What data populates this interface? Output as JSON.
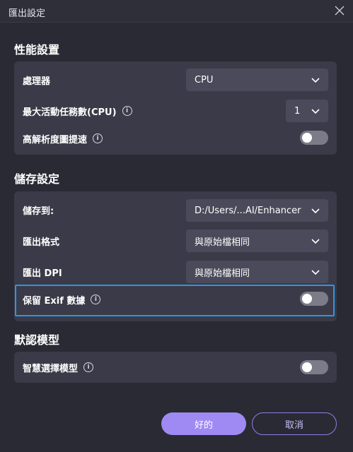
{
  "dialog": {
    "title": "匯出設定"
  },
  "performance": {
    "title": "性能設置",
    "processor_label": "處理器",
    "processor_value": "CPU",
    "max_tasks_label": "最大活動任務數(CPU)",
    "max_tasks_value": "1",
    "hires_accel_label": "高解析度圖提速",
    "hires_accel_enabled": false
  },
  "storage": {
    "title": "儲存設定",
    "save_to_label": "儲存到:",
    "save_to_value": "D:/Users/...AI/Enhancer",
    "export_format_label": "匯出格式",
    "export_format_value": "與原始檔相同",
    "export_dpi_label": "匯出 DPI",
    "export_dpi_value": "與原始檔相同",
    "keep_exif_label": "保留 Exif 數據",
    "keep_exif_enabled": false
  },
  "default_model": {
    "title": "默認模型",
    "smart_select_label": "智慧選擇模型",
    "smart_select_enabled": false
  },
  "footer": {
    "ok_label": "好的",
    "cancel_label": "取消"
  },
  "colors": {
    "background": "#2a2a34",
    "card": "#3a3a48",
    "select": "#4a4a5a",
    "accent": "#9f8af4",
    "highlight": "#2f95e0"
  },
  "icons": [
    "close-icon",
    "info-icon",
    "chevron-down-icon"
  ]
}
